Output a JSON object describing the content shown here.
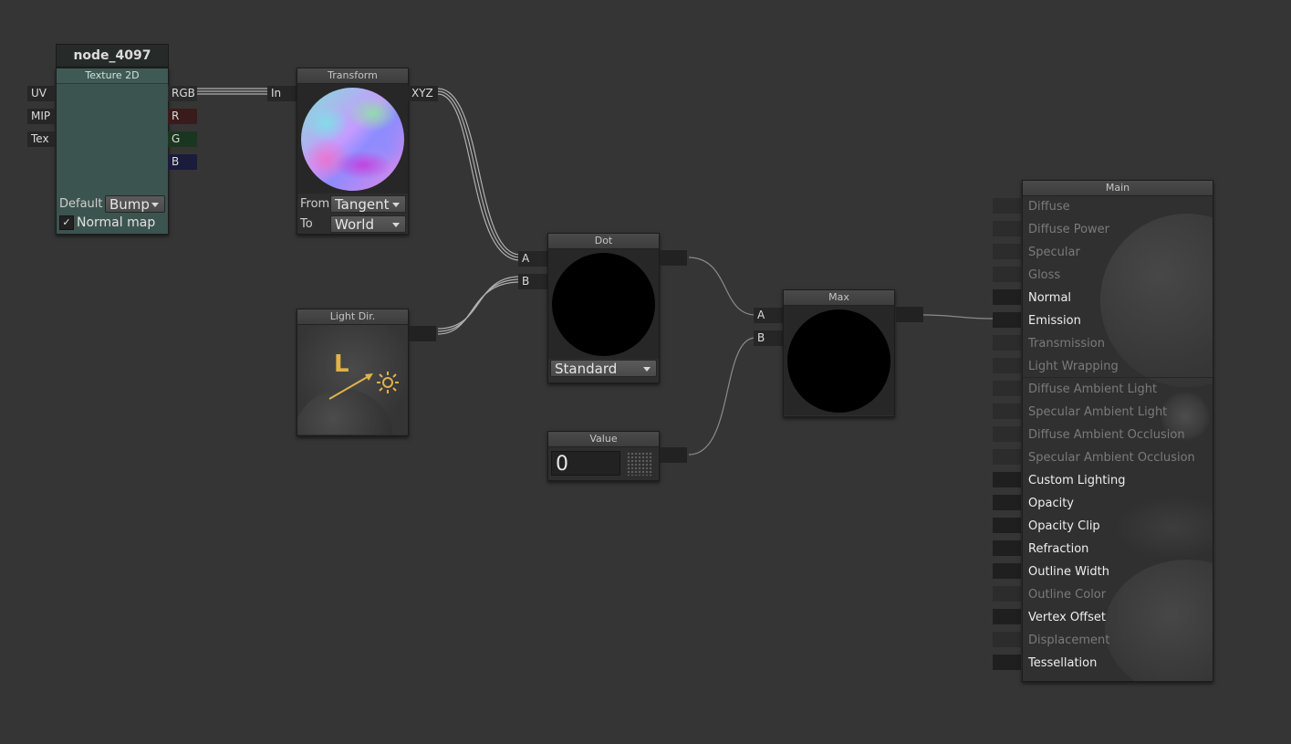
{
  "colors": {
    "canvas": "#353535",
    "texture_node": "#3c544f",
    "port_r": "#3a1b1b",
    "port_g": "#1a3620",
    "port_b": "#1b1b3c",
    "light_icon": "#e0b24a"
  },
  "texture_node": {
    "name": "node_4097",
    "title": "Texture 2D",
    "inputs": [
      "UV",
      "MIP",
      "Tex"
    ],
    "outputs": [
      "RGB",
      "R",
      "G",
      "B"
    ],
    "default_label": "Default",
    "default_value": "Bump",
    "normal_map_label": "Normal map",
    "normal_map_checked": true
  },
  "transform_node": {
    "title": "Transform",
    "input": "In",
    "output": "XYZ",
    "from_label": "From",
    "from_value": "Tangent",
    "to_label": "To",
    "to_value": "World"
  },
  "light_dir_node": {
    "title": "Light Dir.",
    "icon_letter": "L",
    "icon": "sun-icon"
  },
  "dot_node": {
    "title": "Dot",
    "inputs": [
      "A",
      "B"
    ],
    "mode": "Standard"
  },
  "value_node": {
    "title": "Value",
    "value": "0"
  },
  "max_node": {
    "title": "Max",
    "inputs": [
      "A",
      "B"
    ]
  },
  "main_node": {
    "title": "Main",
    "inputs": [
      {
        "label": "Diffuse",
        "active": false
      },
      {
        "label": "Diffuse Power",
        "active": false
      },
      {
        "label": "Specular",
        "active": false
      },
      {
        "label": "Gloss",
        "active": false
      },
      {
        "label": "Normal",
        "active": true
      },
      {
        "label": "Emission",
        "active": true
      },
      {
        "label": "Transmission",
        "active": false
      },
      {
        "label": "Light Wrapping",
        "active": false
      },
      {
        "label": "Diffuse Ambient Light",
        "active": false
      },
      {
        "label": "Specular Ambient Light",
        "active": false
      },
      {
        "label": "Diffuse Ambient Occlusion",
        "active": false
      },
      {
        "label": "Specular Ambient Occlusion",
        "active": false
      },
      {
        "label": "Custom Lighting",
        "active": true
      },
      {
        "label": "Opacity",
        "active": true
      },
      {
        "label": "Opacity Clip",
        "active": true
      },
      {
        "label": "Refraction",
        "active": true
      },
      {
        "label": "Outline Width",
        "active": true
      },
      {
        "label": "Outline Color",
        "active": false
      },
      {
        "label": "Vertex Offset",
        "active": true
      },
      {
        "label": "Displacement",
        "active": false
      },
      {
        "label": "Tessellation",
        "active": true
      }
    ]
  }
}
